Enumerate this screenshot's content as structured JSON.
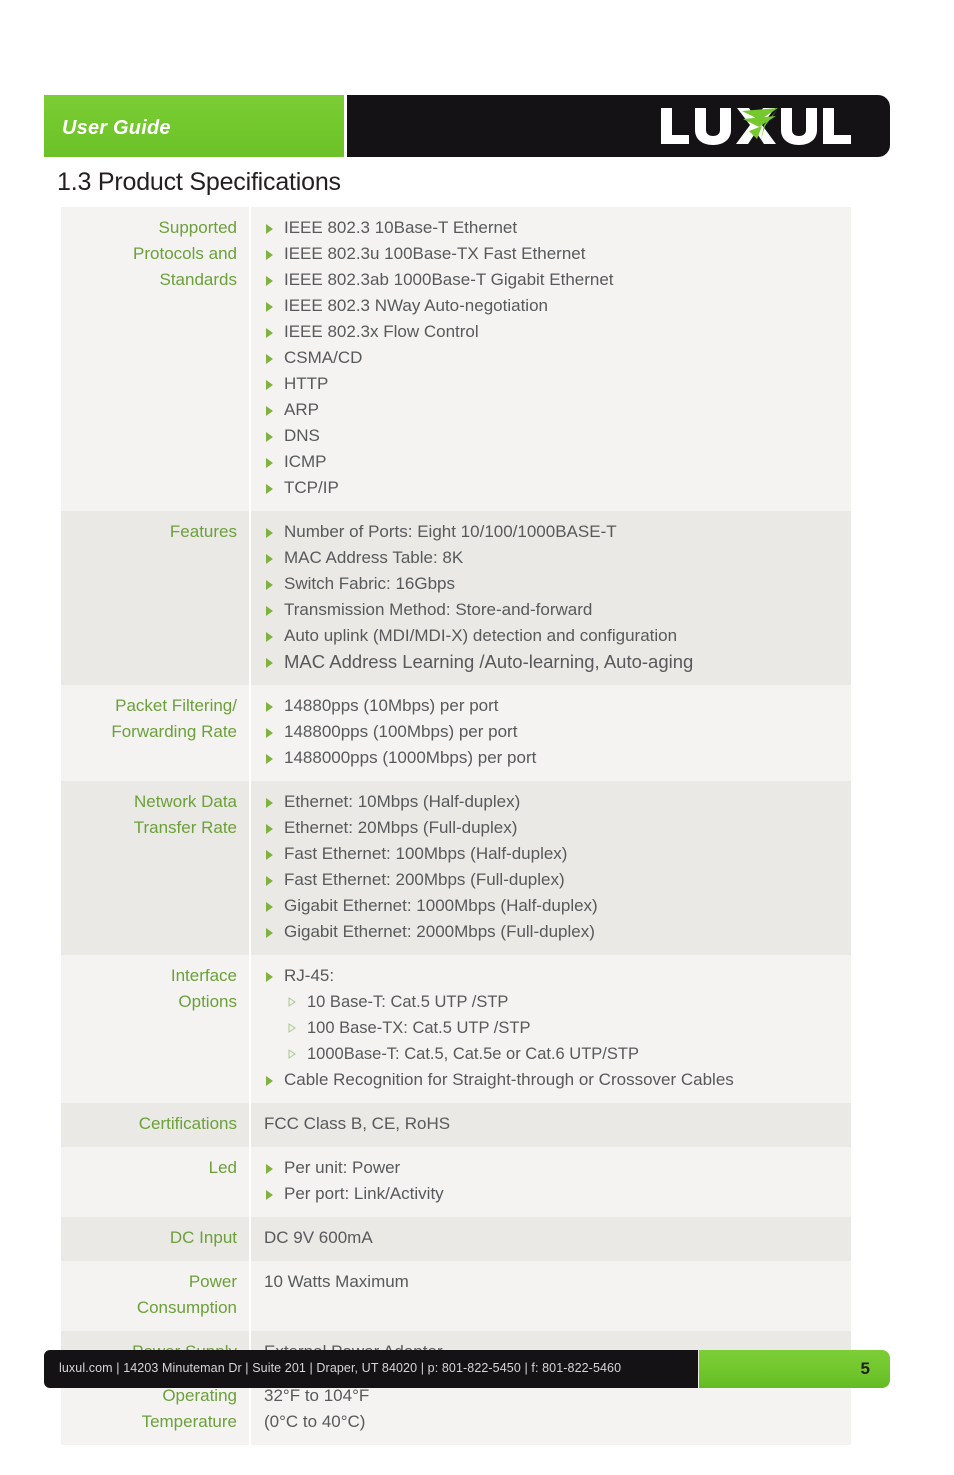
{
  "header": {
    "guide_label": "User Guide",
    "brand": "LUXUL",
    "green_hex": "#74c92e",
    "black_hex": "#141214"
  },
  "section": {
    "title": "1.3 Product Specifications"
  },
  "colors": {
    "label_green": "#6ba03a",
    "body_gray": "#58595b",
    "row_light": "#f4f3f1",
    "row_dark": "#eae9e5"
  },
  "spec_rows": [
    {
      "label": "Supported Protocols and Standards",
      "label_lines": [
        "Supported",
        "Protocols and",
        "Standards"
      ],
      "items": [
        "IEEE 802.3 10Base-T Ethernet",
        "IEEE 802.3u 100Base-TX Fast Ethernet",
        "IEEE 802.3ab 1000Base-T Gigabit Ethernet",
        "IEEE 802.3 NWay Auto-negotiation",
        "IEEE 802.3x Flow Control",
        "CSMA/CD",
        "HTTP",
        "ARP",
        "DNS",
        "ICMP",
        "TCP/IP"
      ]
    },
    {
      "label": "Features",
      "label_lines": [
        "Features"
      ],
      "items": [
        "Number of Ports: Eight 10/100/1000BASE-T",
        "MAC Address Table: 8K",
        "Switch Fabric: 16Gbps",
        "Transmission Method: Store-and-forward",
        "Auto uplink (MDI/MDI-X) detection and configuration",
        "MAC Address Learning /Auto-learning, Auto-aging"
      ]
    },
    {
      "label": "Packet Filtering/ Forwarding Rate",
      "label_lines": [
        "Packet Filtering/",
        "Forwarding Rate"
      ],
      "items": [
        "14880pps (10Mbps) per port",
        "148800pps (100Mbps) per port",
        "1488000pps (1000Mbps) per port"
      ]
    },
    {
      "label": "Network Data Transfer Rate",
      "label_lines": [
        "Network Data",
        "Transfer Rate"
      ],
      "items": [
        "Ethernet: 10Mbps (Half-duplex)",
        "Ethernet: 20Mbps (Full-duplex)",
        "Fast Ethernet: 100Mbps (Half-duplex)",
        "Fast Ethernet: 200Mbps (Full-duplex)",
        "Gigabit Ethernet: 1000Mbps (Half-duplex)",
        "Gigabit Ethernet: 2000Mbps (Full-duplex)"
      ]
    },
    {
      "label": "Interface Options",
      "label_lines": [
        "Interface",
        "Options"
      ],
      "items": [
        "RJ-45:",
        "10 Base-T: Cat.5 UTP /STP",
        "100 Base-TX: Cat.5 UTP /STP",
        "1000Base-T: Cat.5, Cat.5e or Cat.6 UTP/STP",
        "Cable Recognition for Straight-through or Crossover Cables"
      ]
    },
    {
      "label": "Certifications",
      "label_lines": [
        "Certifications"
      ],
      "items": [
        "FCC Class B, CE, RoHS"
      ]
    },
    {
      "label": "Led",
      "label_lines": [
        "Led"
      ],
      "items": [
        "Per unit: Power",
        "Per port: Link/Activity"
      ]
    },
    {
      "label": "DC Input",
      "label_lines": [
        "DC Input"
      ],
      "items": [
        "DC 9V 600mA"
      ]
    },
    {
      "label": "Power Consumption",
      "label_lines": [
        "Power",
        "Consumption"
      ],
      "items": [
        "10 Watts Maximum"
      ]
    },
    {
      "label": "Power Supply",
      "label_lines": [
        "Power Supply"
      ],
      "items": [
        "External Power Adapter"
      ]
    },
    {
      "label": "Operating Temperature",
      "label_lines": [
        "Operating",
        "Temperature"
      ],
      "items": [
        "32°F to 104°F",
        "(0°C to 40°C)"
      ]
    }
  ],
  "rows_text": {
    "r0": {
      "label_l1": "Supported",
      "label_l2": "Protocols and",
      "label_l3": "Standards",
      "i0": "IEEE 802.3 10Base-T Ethernet",
      "i1": "IEEE 802.3u 100Base-TX Fast Ethernet",
      "i2": "IEEE 802.3ab 1000Base-T Gigabit Ethernet",
      "i3": "IEEE 802.3 NWay Auto-negotiation",
      "i4": "IEEE 802.3x Flow Control",
      "i5": "CSMA/CD",
      "i6": "HTTP",
      "i7": "ARP",
      "i8": "DNS",
      "i9": "ICMP",
      "i10": "TCP/IP"
    },
    "r1": {
      "label_l1": "Features",
      "i0": "Number of Ports: Eight 10/100/1000BASE-T",
      "i1": "MAC Address Table: 8K",
      "i2": "Switch Fabric: 16Gbps",
      "i3": "Transmission Method: Store-and-forward",
      "i4": "Auto uplink (MDI/MDI-X) detection and configuration",
      "i5": "MAC Address Learning /Auto-learning, Auto-aging"
    },
    "r2": {
      "label_l1": "Packet Filtering/",
      "label_l2": "Forwarding Rate",
      "i0": "14880pps (10Mbps) per port",
      "i1": "148800pps (100Mbps) per port",
      "i2": "1488000pps (1000Mbps) per port"
    },
    "r3": {
      "label_l1": "Network Data",
      "label_l2": "Transfer Rate",
      "i0": "Ethernet: 10Mbps (Half-duplex)",
      "i1": "Ethernet: 20Mbps (Full-duplex)",
      "i2": "Fast Ethernet: 100Mbps (Half-duplex)",
      "i3": "Fast Ethernet: 200Mbps (Full-duplex)",
      "i4": "Gigabit Ethernet: 1000Mbps (Half-duplex)",
      "i5": "Gigabit Ethernet: 2000Mbps (Full-duplex)"
    },
    "r4": {
      "label_l1": "Interface",
      "label_l2": "Options",
      "i0": "RJ-45:",
      "i1": "10 Base-T: Cat.5 UTP /STP",
      "i2": "100 Base-TX: Cat.5 UTP /STP",
      "i3": "1000Base-T: Cat.5, Cat.5e or Cat.6 UTP/STP",
      "i4": "Cable Recognition for Straight-through or Crossover Cables"
    },
    "r5": {
      "label_l1": "Certifications",
      "i0": "FCC Class B, CE, RoHS"
    },
    "r6": {
      "label_l1": "Led",
      "i0": "Per unit: Power",
      "i1": "Per port: Link/Activity"
    },
    "r7": {
      "label_l1": "DC Input",
      "i0": "DC 9V 600mA"
    },
    "r8": {
      "label_l1": "Power",
      "label_l2": "Consumption",
      "i0": "10 Watts Maximum"
    },
    "r9": {
      "label_l1": "Power Supply",
      "i0": "External Power Adapter"
    },
    "r10": {
      "label_l1": "Operating",
      "label_l2": "Temperature",
      "i0": "32°F to 104°F",
      "i1": "(0°C to 40°C)"
    }
  },
  "footer": {
    "info": "luxul.com  |  14203 Minuteman Dr |  Suite 201  |  Draper, UT 84020  |  p: 801-822-5450  |  f: 801-822-5460",
    "page_number": "5"
  }
}
